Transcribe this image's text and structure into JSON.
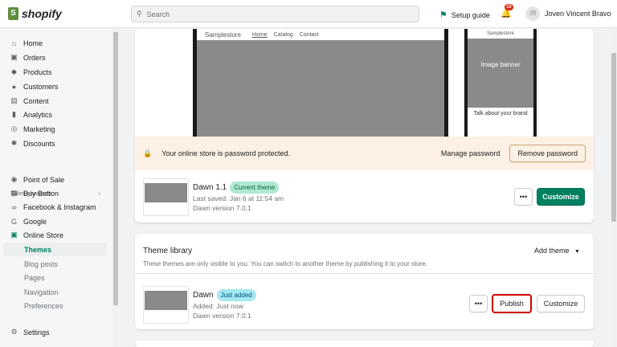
{
  "topbar": {
    "brand": "shopify",
    "search_placeholder": "Search",
    "setup_guide": "Setup guide",
    "notifications_count": "10",
    "user_initials": "JB",
    "user_name": "Joven Vincent Bravo"
  },
  "sidebar": {
    "items": [
      {
        "label": "Home",
        "icon": "home-icon"
      },
      {
        "label": "Orders",
        "icon": "orders-icon"
      },
      {
        "label": "Products",
        "icon": "tag-icon"
      },
      {
        "label": "Customers",
        "icon": "person-icon"
      },
      {
        "label": "Content",
        "icon": "content-icon"
      },
      {
        "label": "Analytics",
        "icon": "analytics-icon"
      },
      {
        "label": "Marketing",
        "icon": "marketing-icon"
      },
      {
        "label": "Discounts",
        "icon": "discount-icon"
      }
    ],
    "sales_channels_label": "Sales channels",
    "channels": [
      {
        "label": "Point of Sale"
      },
      {
        "label": "Buy Button"
      },
      {
        "label": "Facebook & Instagram"
      },
      {
        "label": "Google"
      },
      {
        "label": "Online Store"
      }
    ],
    "online_store_sub": [
      {
        "label": "Themes"
      },
      {
        "label": "Blog posts"
      },
      {
        "label": "Pages"
      },
      {
        "label": "Navigation"
      },
      {
        "label": "Preferences"
      }
    ],
    "settings": "Settings"
  },
  "preview": {
    "store_name": "Samplestore",
    "nav": [
      "Home",
      "Catalog",
      "Contact"
    ],
    "mobile_banner": "Image banner",
    "mobile_brand": "Talk about your brand"
  },
  "password_banner": {
    "text": "Your online store is password protected.",
    "manage": "Manage password",
    "remove": "Remove password"
  },
  "current_theme": {
    "name": "Dawn 1.1",
    "badge": "Current theme",
    "last_saved": "Last saved: Jan 6 at 11:54 am",
    "version": "Dawn version 7.0.1",
    "more": "•••",
    "customize": "Customize"
  },
  "library": {
    "title": "Theme library",
    "add_theme": "Add theme",
    "description": "These themes are only visible to you. You can switch to another theme by publishing it to your store.",
    "themes": [
      {
        "name": "Dawn",
        "badge": "Just added",
        "added": "Added: Just now",
        "version": "Dawn version 7.0.1",
        "more": "•••",
        "publish": "Publish",
        "customize": "Customize"
      }
    ]
  },
  "colors": {
    "primary": "#008060",
    "highlight": "#d40000",
    "current_badge": "#aee9d1",
    "new_badge": "#a4e8f2",
    "warning_bg": "#fdf0e4"
  }
}
